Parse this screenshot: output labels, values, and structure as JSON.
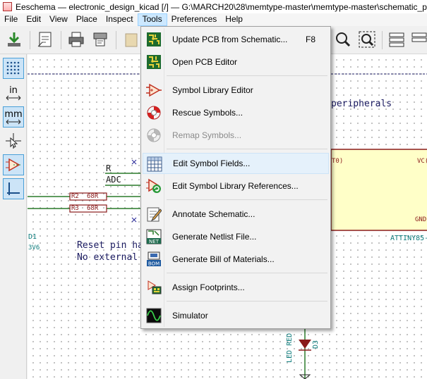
{
  "window": {
    "title": "Eeschema — electronic_design_kicad [/] — G:\\MARCH20\\28\\memtype-master\\memtype-master\\schematic_pcb"
  },
  "menubar": {
    "items": [
      "File",
      "Edit",
      "View",
      "Place",
      "Inspect",
      "Tools",
      "Preferences",
      "Help"
    ],
    "active": "Tools"
  },
  "left_toolbar": {
    "inches_label": "in",
    "mm_label": "mm"
  },
  "tools_menu": {
    "items": [
      {
        "label": "Update PCB from Schematic...",
        "shortcut": "F8",
        "icon": "update-pcb-icon",
        "enabled": true
      },
      {
        "label": "Open PCB Editor",
        "icon": "pcb-editor-icon",
        "enabled": true
      },
      {
        "label": "Symbol Library Editor",
        "icon": "symbol-editor-icon",
        "enabled": true
      },
      {
        "label": "Rescue Symbols...",
        "icon": "rescue-lifebuoy-icon",
        "enabled": true
      },
      {
        "label": "Remap Symbols...",
        "icon": "remap-lifebuoy-icon",
        "enabled": false
      },
      {
        "label": "Edit Symbol Fields...",
        "icon": "table-grid-icon",
        "enabled": true,
        "highlighted": true
      },
      {
        "label": "Edit Symbol Library References...",
        "icon": "library-refs-icon",
        "enabled": true
      },
      {
        "label": "Annotate Schematic...",
        "icon": "annotate-pencil-icon",
        "enabled": true
      },
      {
        "label": "Generate Netlist File...",
        "icon": "netlist-icon",
        "icon_text": "NET",
        "enabled": true
      },
      {
        "label": "Generate Bill of Materials...",
        "icon": "bom-icon",
        "icon_text": "BOM",
        "enabled": true
      },
      {
        "label": "Assign Footprints...",
        "icon": "footprint-icon",
        "enabled": true
      },
      {
        "label": "Simulator",
        "icon": "simulator-wave-icon",
        "enabled": true
      }
    ]
  },
  "schematic": {
    "label_r": "R",
    "label_adc": "ADC",
    "r2_ref": "R2",
    "r2_value": "68R",
    "r3_ref": "R3",
    "r3_value": "68R",
    "d1_ref": "D1",
    "d1_value": "3V6",
    "note_line1": "Reset pin ha",
    "note_line2": "No external",
    "peripherals_text": "peripherals",
    "pin_t0": "T0)",
    "pin_vcc": "VC(",
    "pin_gnd": "GND",
    "ic_ref": "ATTINY85-",
    "led_label": "LED RED",
    "d3_ref": "D3"
  }
}
